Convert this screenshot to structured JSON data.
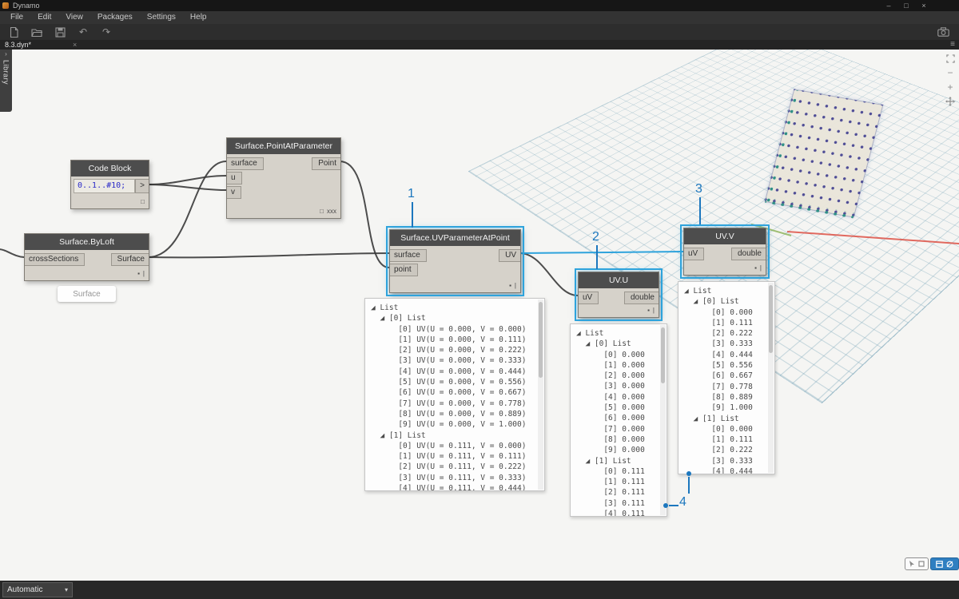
{
  "colors": {
    "selection_blue": "#2ea3dc",
    "annotation_blue": "#1c77be",
    "wire_dark": "#3a3a3a",
    "wire_selected": "#2ea3dc",
    "canvas_bg": "#f5f5f3",
    "node_body": "#d6d2ca",
    "node_header": "#4d4d4d",
    "grid_line": "#78a5b9",
    "surface_dot_purple": "#4e4c96",
    "surface_edge_dot_teal": "#2f8f86",
    "axis_x_red": "#dd5044",
    "axis_y_green": "#7ca83f"
  },
  "window": {
    "title": "Dynamo",
    "minimize": "–",
    "maximize": "□",
    "close": "×"
  },
  "menu": {
    "items": [
      "File",
      "Edit",
      "View",
      "Packages",
      "Settings",
      "Help"
    ]
  },
  "toolbar": {
    "icons": [
      "new-file",
      "open-file",
      "save",
      "undo",
      "redo"
    ],
    "right_icon": "screenshot-camera",
    "undo_glyph": "↶",
    "redo_glyph": "↷"
  },
  "tabs": {
    "active": {
      "label": "8.3.dyn*",
      "close": "×"
    },
    "overflow_icon": "≡"
  },
  "library": {
    "label": "Library",
    "collapse_icon": "›"
  },
  "canvas": {
    "glyphs": {
      "preview_on": "▪",
      "preview_off": "□",
      "lacing_single": "|",
      "lacing_cross": "xxx"
    },
    "nodes": {
      "code_block": {
        "title": "Code Block",
        "code": "0..1..#10;",
        "output": ">"
      },
      "point_at_parameter": {
        "title": "Surface.PointAtParameter",
        "inputs": [
          "surface",
          "u",
          "v"
        ],
        "output": "Point"
      },
      "by_loft": {
        "title": "Surface.ByLoft",
        "inputs": [
          "crossSections"
        ],
        "output": "Surface",
        "preview": "Surface"
      },
      "uv_parameter_at_point": {
        "title": "Surface.UVParameterAtPoint",
        "inputs": [
          "surface",
          "point"
        ],
        "output": "UV"
      },
      "uv_u": {
        "title": "UV.U",
        "inputs": [
          "uV"
        ],
        "output": "double"
      },
      "uv_v": {
        "title": "UV.V",
        "inputs": [
          "uV"
        ],
        "output": "double"
      }
    },
    "watch_lists": {
      "uv_pairs": {
        "lines": [
          "◢ List",
          "  ◢ [0] List",
          "      [0] UV(U = 0.000, V = 0.000)",
          "      [1] UV(U = 0.000, V = 0.111)",
          "      [2] UV(U = 0.000, V = 0.222)",
          "      [3] UV(U = 0.000, V = 0.333)",
          "      [4] UV(U = 0.000, V = 0.444)",
          "      [5] UV(U = 0.000, V = 0.556)",
          "      [6] UV(U = 0.000, V = 0.667)",
          "      [7] UV(U = 0.000, V = 0.778)",
          "      [8] UV(U = 0.000, V = 0.889)",
          "      [9] UV(U = 0.000, V = 1.000)",
          "  ◢ [1] List",
          "      [0] UV(U = 0.111, V = 0.000)",
          "      [1] UV(U = 0.111, V = 0.111)",
          "      [2] UV(U = 0.111, V = 0.222)",
          "      [3] UV(U = 0.111, V = 0.333)",
          "      [4] UV(U = 0.111, V = 0.444)"
        ]
      },
      "u_values": {
        "lines": [
          "◢ List",
          "  ◢ [0] List",
          "      [0] 0.000",
          "      [1] 0.000",
          "      [2] 0.000",
          "      [3] 0.000",
          "      [4] 0.000",
          "      [5] 0.000",
          "      [6] 0.000",
          "      [7] 0.000",
          "      [8] 0.000",
          "      [9] 0.000",
          "  ◢ [1] List",
          "      [0] 0.111",
          "      [1] 0.111",
          "      [2] 0.111",
          "      [3] 0.111",
          "      [4] 0.111"
        ]
      },
      "v_values": {
        "lines": [
          "◢ List",
          "  ◢ [0] List",
          "      [0] 0.000",
          "      [1] 0.111",
          "      [2] 0.222",
          "      [3] 0.333",
          "      [4] 0.444",
          "      [5] 0.556",
          "      [6] 0.667",
          "      [7] 0.778",
          "      [8] 0.889",
          "      [9] 1.000",
          "  ◢ [1] List",
          "      [0] 0.000",
          "      [1] 0.111",
          "      [2] 0.222",
          "      [3] 0.333",
          "      [4] 0.444"
        ]
      }
    },
    "annotations": {
      "n1": "1",
      "n2": "2",
      "n3": "3",
      "n4": "4"
    }
  },
  "statusbar": {
    "run_mode": "Automatic",
    "caret": "▾"
  }
}
